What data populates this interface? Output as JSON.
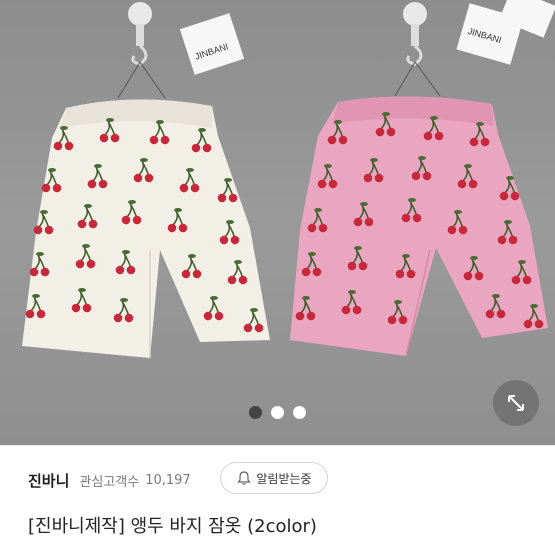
{
  "product_image": {
    "tag_text": "JINBANI",
    "slide_count": 3,
    "active_slide": 1
  },
  "seller": {
    "name": "진바니",
    "favorite_label": "관심고객수",
    "favorite_count": "10,197"
  },
  "notify_button": {
    "label": "알림받는중",
    "icon": "bell-icon"
  },
  "product": {
    "title": "[진바니제작] 앵두 바지 잠옷 (2color)"
  },
  "colors": {
    "text": "#222222",
    "muted": "#7a7a7a",
    "white_shorts": "#f2efe6",
    "pink_shorts": "#eaa6c0",
    "cherry": "#c8283c"
  }
}
